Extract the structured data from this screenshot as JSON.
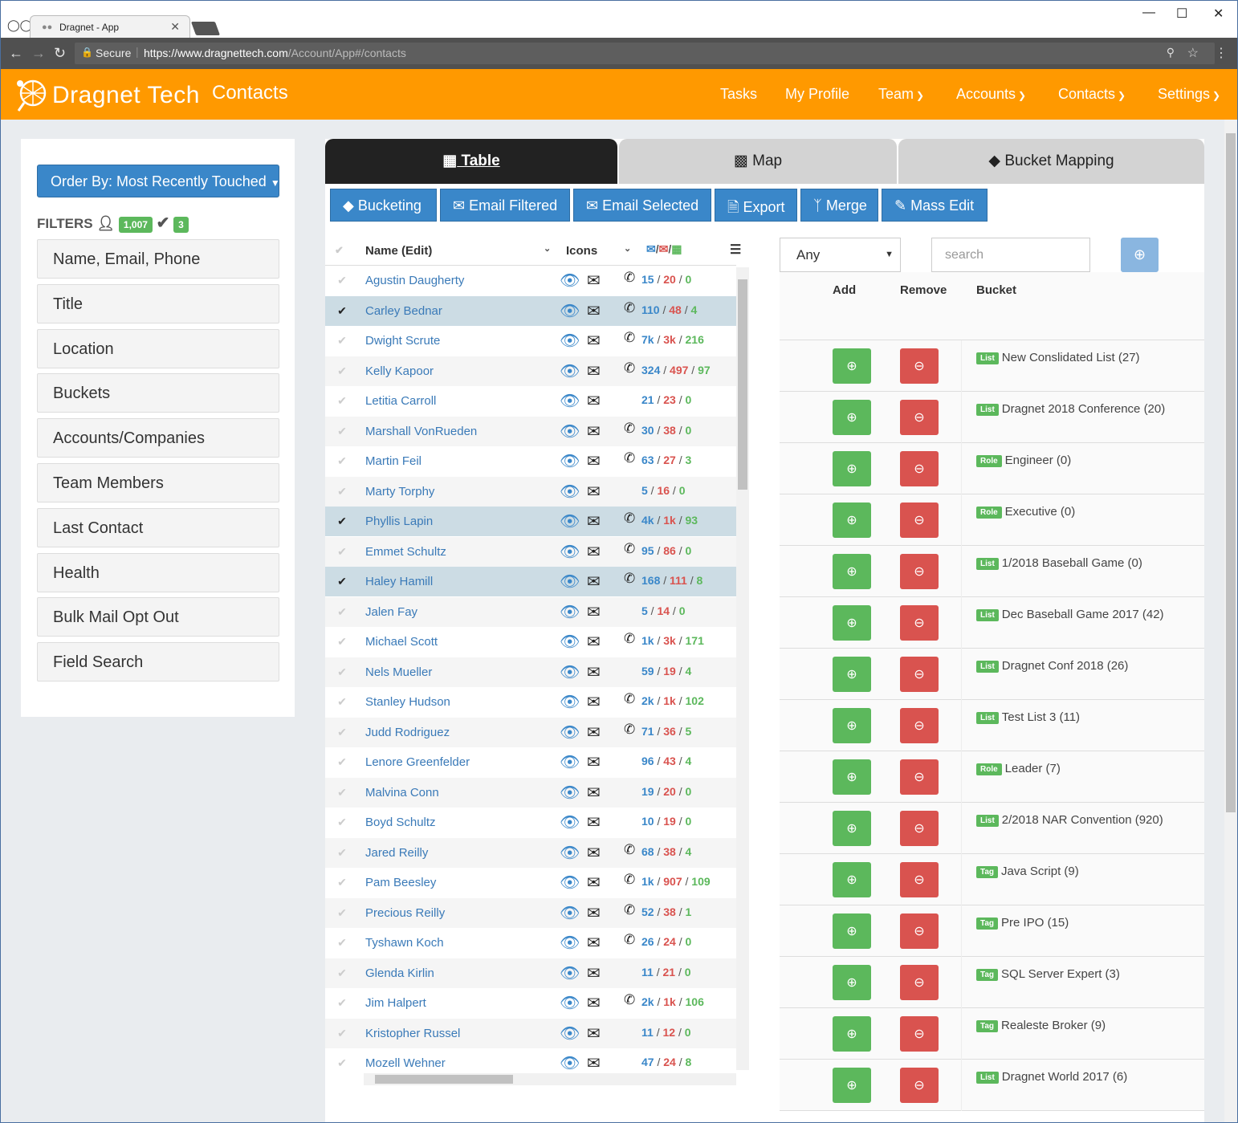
{
  "browser": {
    "tab_title": "Dragnet - App",
    "url_secure": "Secure",
    "url_host": "https://www.dragnettech.com",
    "url_path": "/Account/App#/contacts"
  },
  "navbar": {
    "brand": "Dragnet Tech",
    "page_title": "Contacts",
    "links": [
      {
        "label": "Tasks",
        "dropdown": false
      },
      {
        "label": "My Profile",
        "dropdown": false
      },
      {
        "label": "Team",
        "dropdown": true
      },
      {
        "label": "Accounts",
        "dropdown": true
      },
      {
        "label": "Contacts",
        "dropdown": true
      },
      {
        "label": "Settings",
        "dropdown": true
      }
    ]
  },
  "sidebar": {
    "order_by": "Order By: Most Recently Touched",
    "filters_label": "FILTERS",
    "total_count": "1,007",
    "selected_count": "3",
    "filters": [
      "Name, Email, Phone",
      "Title",
      "Location",
      "Buckets",
      "Accounts/Companies",
      "Team Members",
      "Last Contact",
      "Health",
      "Bulk Mail Opt Out",
      "Field Search"
    ]
  },
  "views": {
    "table": "Table",
    "map": "Map",
    "bucket": "Bucket Mapping"
  },
  "actions": [
    "Bucketing",
    "Email Filtered",
    "Email Selected",
    "Export",
    "Merge",
    "Mass Edit"
  ],
  "table": {
    "col_name": "Name (Edit)",
    "col_icons": "Icons",
    "rows": [
      {
        "name": "Agustin Daugherty",
        "selected": false,
        "phone": true,
        "a": "15",
        "b": "20",
        "c": "0"
      },
      {
        "name": "Carley Bednar",
        "selected": true,
        "phone": true,
        "a": "110",
        "b": "48",
        "c": "4"
      },
      {
        "name": "Dwight Scrute",
        "selected": false,
        "phone": true,
        "a": "7k",
        "b": "3k",
        "c": "216"
      },
      {
        "name": "Kelly Kapoor",
        "selected": false,
        "phone": true,
        "a": "324",
        "b": "497",
        "c": "97"
      },
      {
        "name": "Letitia Carroll",
        "selected": false,
        "phone": false,
        "a": "21",
        "b": "23",
        "c": "0"
      },
      {
        "name": "Marshall VonRueden",
        "selected": false,
        "phone": true,
        "a": "30",
        "b": "38",
        "c": "0"
      },
      {
        "name": "Martin Feil",
        "selected": false,
        "phone": true,
        "a": "63",
        "b": "27",
        "c": "3"
      },
      {
        "name": "Marty Torphy",
        "selected": false,
        "phone": false,
        "a": "5",
        "b": "16",
        "c": "0"
      },
      {
        "name": "Phyllis Lapin",
        "selected": true,
        "phone": true,
        "a": "4k",
        "b": "1k",
        "c": "93"
      },
      {
        "name": "Emmet Schultz",
        "selected": false,
        "phone": true,
        "a": "95",
        "b": "86",
        "c": "0"
      },
      {
        "name": "Haley Hamill",
        "selected": true,
        "phone": true,
        "a": "168",
        "b": "111",
        "c": "8"
      },
      {
        "name": "Jalen Fay",
        "selected": false,
        "phone": false,
        "a": "5",
        "b": "14",
        "c": "0"
      },
      {
        "name": "Michael Scott",
        "selected": false,
        "phone": true,
        "a": "1k",
        "b": "3k",
        "c": "171"
      },
      {
        "name": "Nels Mueller",
        "selected": false,
        "phone": false,
        "a": "59",
        "b": "19",
        "c": "4"
      },
      {
        "name": "Stanley Hudson",
        "selected": false,
        "phone": true,
        "a": "2k",
        "b": "1k",
        "c": "102"
      },
      {
        "name": "Judd Rodriguez",
        "selected": false,
        "phone": true,
        "a": "71",
        "b": "36",
        "c": "5"
      },
      {
        "name": "Lenore Greenfelder",
        "selected": false,
        "phone": false,
        "a": "96",
        "b": "43",
        "c": "4"
      },
      {
        "name": "Malvina Conn",
        "selected": false,
        "phone": false,
        "a": "19",
        "b": "20",
        "c": "0"
      },
      {
        "name": "Boyd Schultz",
        "selected": false,
        "phone": false,
        "a": "10",
        "b": "19",
        "c": "0"
      },
      {
        "name": "Jared Reilly",
        "selected": false,
        "phone": true,
        "a": "68",
        "b": "38",
        "c": "4"
      },
      {
        "name": "Pam Beesley",
        "selected": false,
        "phone": true,
        "a": "1k",
        "b": "907",
        "c": "109"
      },
      {
        "name": "Precious Reilly",
        "selected": false,
        "phone": true,
        "a": "52",
        "b": "38",
        "c": "1"
      },
      {
        "name": "Tyshawn Koch",
        "selected": false,
        "phone": true,
        "a": "26",
        "b": "24",
        "c": "0"
      },
      {
        "name": "Glenda Kirlin",
        "selected": false,
        "phone": false,
        "a": "11",
        "b": "21",
        "c": "0"
      },
      {
        "name": "Jim Halpert",
        "selected": false,
        "phone": true,
        "a": "2k",
        "b": "1k",
        "c": "106"
      },
      {
        "name": "Kristopher Russel",
        "selected": false,
        "phone": false,
        "a": "11",
        "b": "12",
        "c": "0"
      },
      {
        "name": "Mozell Wehner",
        "selected": false,
        "phone": false,
        "a": "47",
        "b": "24",
        "c": "8"
      }
    ]
  },
  "buckets": {
    "type_select": "Any",
    "search_placeholder": "search",
    "col_add": "Add",
    "col_remove": "Remove",
    "col_bucket": "Bucket",
    "items": [
      {
        "type": "List",
        "name": "New Conslidated List (27)"
      },
      {
        "type": "List",
        "name": "Dragnet 2018 Conference (20)"
      },
      {
        "type": "Role",
        "name": "Engineer (0)"
      },
      {
        "type": "Role",
        "name": "Executive (0)"
      },
      {
        "type": "List",
        "name": "1/2018 Baseball Game (0)"
      },
      {
        "type": "List",
        "name": "Dec Baseball Game 2017 (42)"
      },
      {
        "type": "List",
        "name": "Dragnet Conf 2018 (26)"
      },
      {
        "type": "List",
        "name": "Test List 3 (11)"
      },
      {
        "type": "Role",
        "name": "Leader (7)"
      },
      {
        "type": "List",
        "name": "2/2018 NAR Convention (920)"
      },
      {
        "type": "Tag",
        "name": "Java Script (9)"
      },
      {
        "type": "Tag",
        "name": "Pre IPO (15)"
      },
      {
        "type": "Tag",
        "name": "SQL Server Expert (3)"
      },
      {
        "type": "Tag",
        "name": "Realeste Broker (9)"
      },
      {
        "type": "List",
        "name": "Dragnet World 2017 (6)"
      }
    ]
  },
  "colors": {
    "brand_orange": "#ff9900",
    "primary": "#3a87c9",
    "success": "#5cb85c",
    "danger": "#d9534f"
  }
}
